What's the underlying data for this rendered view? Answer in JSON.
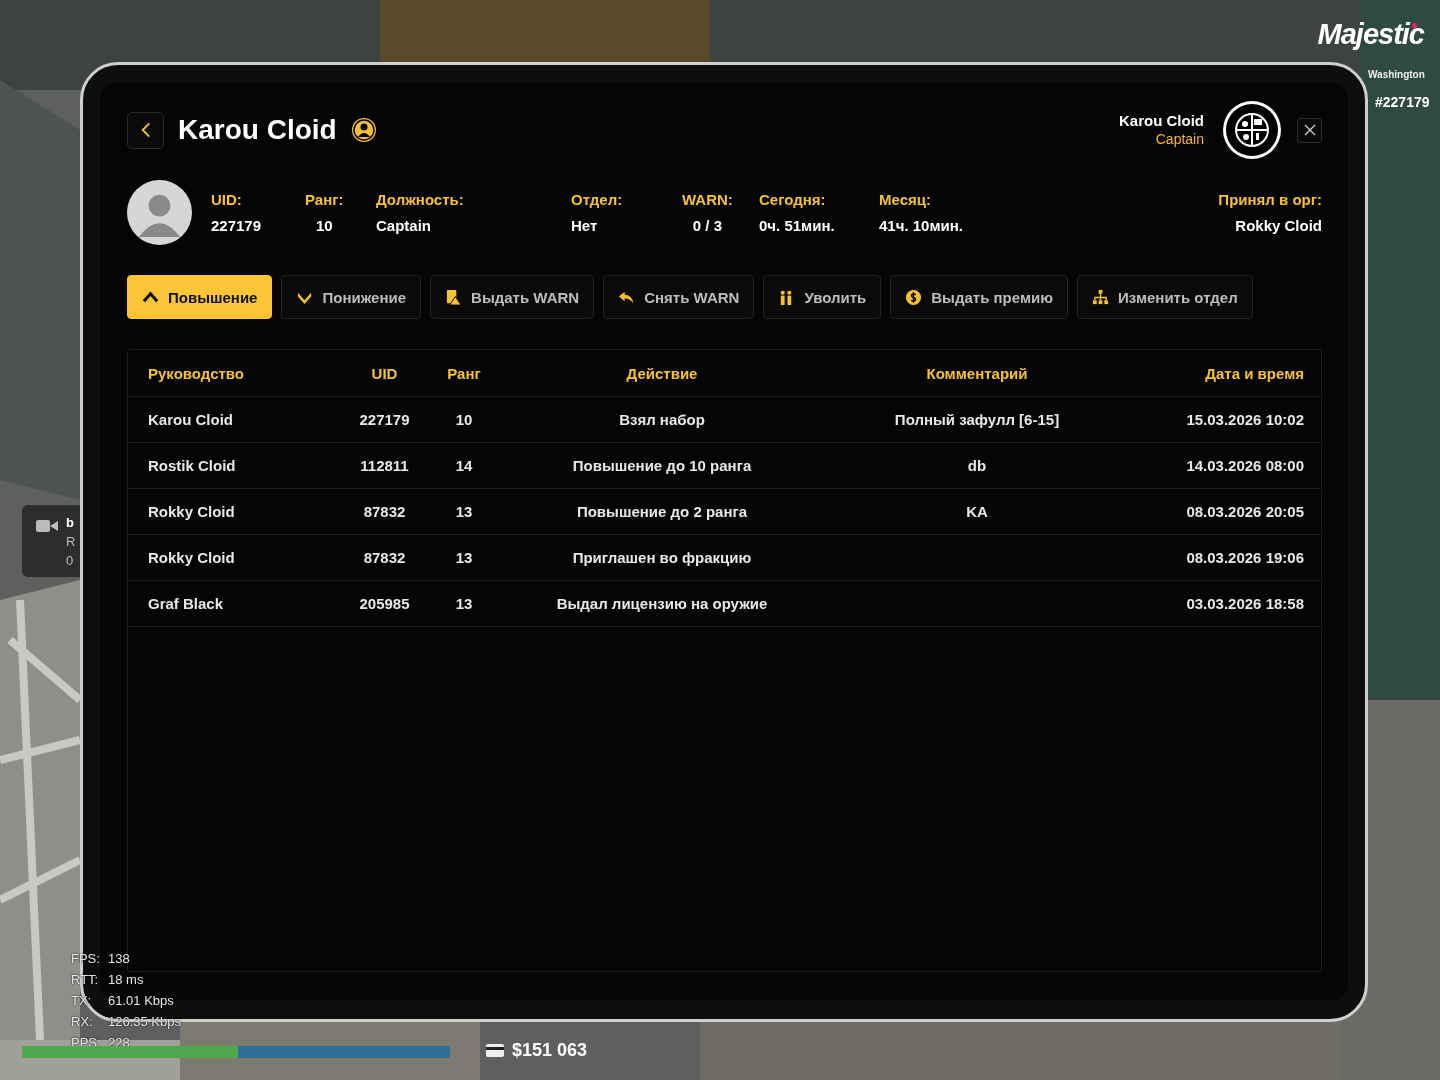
{
  "hud": {
    "logo": "Majestic",
    "server": "Washington",
    "player_id": "#227179",
    "notification_lines": [
      "b",
      "R",
      "0"
    ],
    "net_stats": [
      {
        "label": "FPS:",
        "value": "138"
      },
      {
        "label": "RTT:",
        "value": "18 ms"
      },
      {
        "label": "TX:",
        "value": "61.01 Kbps"
      },
      {
        "label": "RX:",
        "value": "126.35 Kbps"
      },
      {
        "label": "PPS:",
        "value": "228"
      }
    ],
    "bars": [
      {
        "level": 1
      },
      {
        "level": 1
      }
    ],
    "cash": "$151 063"
  },
  "profile": {
    "title": "Karou Cloid",
    "viewer": {
      "name": "Karou Cloid",
      "rank": "Captain"
    },
    "stats": [
      {
        "label": "UID:",
        "value": "227179"
      },
      {
        "label": "Ранг:",
        "value": "10"
      },
      {
        "label": "Должность:",
        "value": "Captain"
      },
      {
        "label": "Отдел:",
        "value": "Нет"
      },
      {
        "label": "WARN:",
        "value": "0 / 3"
      },
      {
        "label": "Сегодня:",
        "value": "0ч. 51мин."
      },
      {
        "label": "Месяц:",
        "value": "41ч. 10мин."
      },
      {
        "label": "Принял в орг:",
        "value": "Rokky Cloid"
      }
    ]
  },
  "actions": [
    {
      "label": "Повышение",
      "selected": true
    },
    {
      "label": "Понижение",
      "selected": false
    },
    {
      "label": "Выдать WARN",
      "selected": false
    },
    {
      "label": "Снять WARN",
      "selected": false
    },
    {
      "label": "Уволить",
      "selected": false
    },
    {
      "label": "Выдать премию",
      "selected": false
    },
    {
      "label": "Изменить отдел",
      "selected": false
    }
  ],
  "table": {
    "columns": [
      "Руководство",
      "UID",
      "Ранг",
      "Действие",
      "Комментарий",
      "Дата и время"
    ],
    "rows": [
      [
        "Karou Cloid",
        "227179",
        "10",
        "Взял набор",
        "Полный зафулл [6-15]",
        "15.03.2026 10:02"
      ],
      [
        "Rostik Cloid",
        "112811",
        "14",
        "Повышение до 10 ранга",
        "db",
        "14.03.2026 08:00"
      ],
      [
        "Rokky Cloid",
        "87832",
        "13",
        "Повышение до 2 ранга",
        "KA",
        "08.03.2026 20:05"
      ],
      [
        "Rokky Cloid",
        "87832",
        "13",
        "Приглашен во фракцию",
        "",
        "08.03.2026 19:06"
      ],
      [
        "Graf Black",
        "205985",
        "13",
        "Выдал лицензию на оружие",
        "",
        "03.03.2026 18:58"
      ]
    ]
  }
}
